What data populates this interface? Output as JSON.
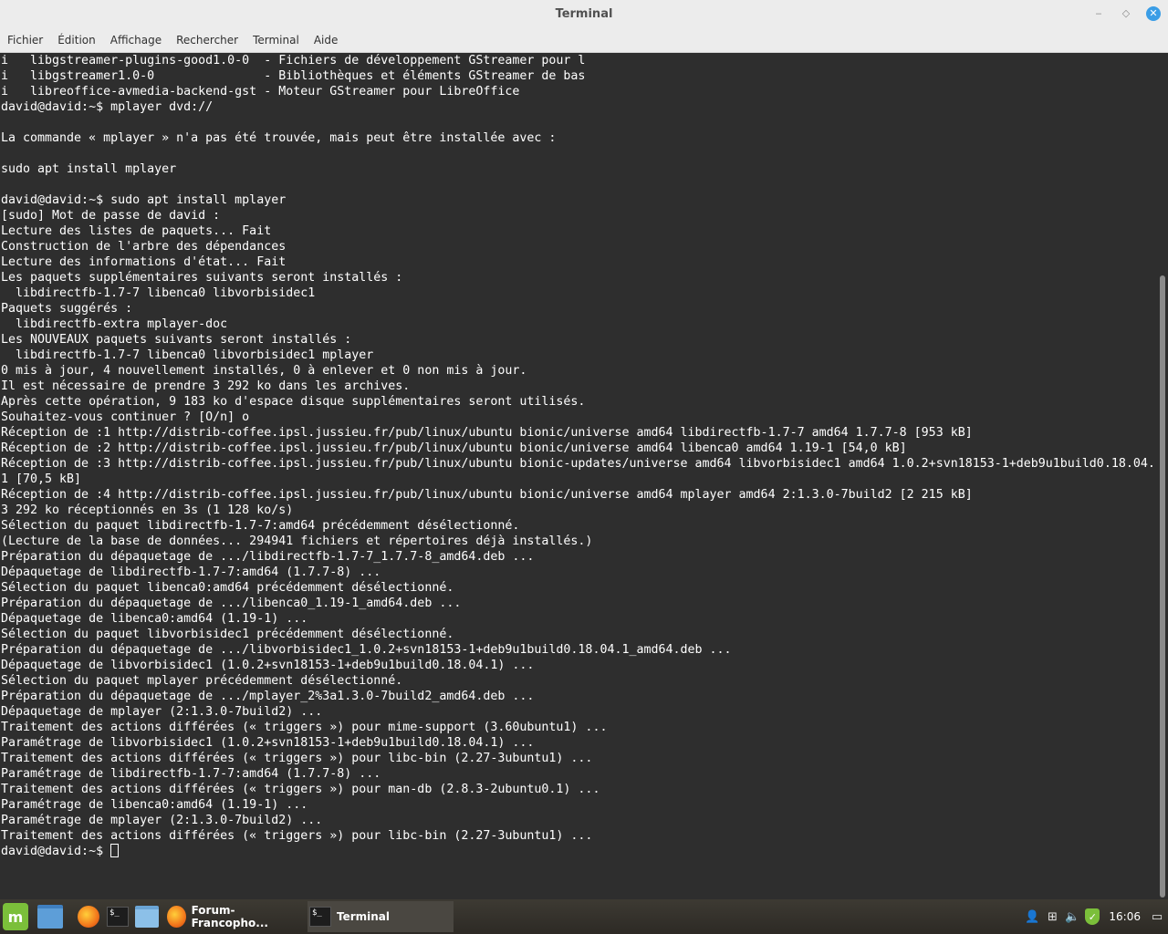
{
  "window": {
    "title": "Terminal",
    "controls": {
      "minimize": "‒",
      "maximize": "◇",
      "close": "✕"
    }
  },
  "menubar": {
    "items": [
      "Fichier",
      "Édition",
      "Affichage",
      "Rechercher",
      "Terminal",
      "Aide"
    ]
  },
  "terminal": {
    "lines": [
      "i   libgstreamer-plugins-good1.0-0  - Fichiers de développement GStreamer pour l",
      "i   libgstreamer1.0-0               - Bibliothèques et éléments GStreamer de bas",
      "i   libreoffice-avmedia-backend-gst - Moteur GStreamer pour LibreOffice",
      "david@david:~$ mplayer dvd://",
      "",
      "La commande « mplayer » n'a pas été trouvée, mais peut être installée avec :",
      "",
      "sudo apt install mplayer",
      "",
      "david@david:~$ sudo apt install mplayer",
      "[sudo] Mot de passe de david :",
      "Lecture des listes de paquets... Fait",
      "Construction de l'arbre des dépendances",
      "Lecture des informations d'état... Fait",
      "Les paquets supplémentaires suivants seront installés :",
      "  libdirectfb-1.7-7 libenca0 libvorbisidec1",
      "Paquets suggérés :",
      "  libdirectfb-extra mplayer-doc",
      "Les NOUVEAUX paquets suivants seront installés :",
      "  libdirectfb-1.7-7 libenca0 libvorbisidec1 mplayer",
      "0 mis à jour, 4 nouvellement installés, 0 à enlever et 0 non mis à jour.",
      "Il est nécessaire de prendre 3 292 ko dans les archives.",
      "Après cette opération, 9 183 ko d'espace disque supplémentaires seront utilisés.",
      "Souhaitez-vous continuer ? [O/n] o",
      "Réception de :1 http://distrib-coffee.ipsl.jussieu.fr/pub/linux/ubuntu bionic/universe amd64 libdirectfb-1.7-7 amd64 1.7.7-8 [953 kB]",
      "Réception de :2 http://distrib-coffee.ipsl.jussieu.fr/pub/linux/ubuntu bionic/universe amd64 libenca0 amd64 1.19-1 [54,0 kB]",
      "Réception de :3 http://distrib-coffee.ipsl.jussieu.fr/pub/linux/ubuntu bionic-updates/universe amd64 libvorbisidec1 amd64 1.0.2+svn18153-1+deb9u1build0.18.04.",
      "1 [70,5 kB]",
      "Réception de :4 http://distrib-coffee.ipsl.jussieu.fr/pub/linux/ubuntu bionic/universe amd64 mplayer amd64 2:1.3.0-7build2 [2 215 kB]",
      "3 292 ko réceptionnés en 3s (1 128 ko/s)",
      "Sélection du paquet libdirectfb-1.7-7:amd64 précédemment désélectionné.",
      "(Lecture de la base de données... 294941 fichiers et répertoires déjà installés.)",
      "Préparation du dépaquetage de .../libdirectfb-1.7-7_1.7.7-8_amd64.deb ...",
      "Dépaquetage de libdirectfb-1.7-7:amd64 (1.7.7-8) ...",
      "Sélection du paquet libenca0:amd64 précédemment désélectionné.",
      "Préparation du dépaquetage de .../libenca0_1.19-1_amd64.deb ...",
      "Dépaquetage de libenca0:amd64 (1.19-1) ...",
      "Sélection du paquet libvorbisidec1 précédemment désélectionné.",
      "Préparation du dépaquetage de .../libvorbisidec1_1.0.2+svn18153-1+deb9u1build0.18.04.1_amd64.deb ...",
      "Dépaquetage de libvorbisidec1 (1.0.2+svn18153-1+deb9u1build0.18.04.1) ...",
      "Sélection du paquet mplayer précédemment désélectionné.",
      "Préparation du dépaquetage de .../mplayer_2%3a1.3.0-7build2_amd64.deb ...",
      "Dépaquetage de mplayer (2:1.3.0-7build2) ...",
      "Traitement des actions différées (« triggers ») pour mime-support (3.60ubuntu1) ...",
      "Paramétrage de libvorbisidec1 (1.0.2+svn18153-1+deb9u1build0.18.04.1) ...",
      "Traitement des actions différées (« triggers ») pour libc-bin (2.27-3ubuntu1) ...",
      "Paramétrage de libdirectfb-1.7-7:amd64 (1.7.7-8) ...",
      "Traitement des actions différées (« triggers ») pour man-db (2.8.3-2ubuntu0.1) ...",
      "Paramétrage de libenca0:amd64 (1.19-1) ...",
      "Paramétrage de mplayer (2:1.3.0-7build2) ...",
      "Traitement des actions différées (« triggers ») pour libc-bin (2.27-3ubuntu1) ..."
    ],
    "prompt": "david@david:~$ "
  },
  "taskbar": {
    "menu_icon": "mint-menu-icon",
    "launchers": [
      "files-icon",
      "firefox-icon",
      "terminal-icon",
      "folder-icon"
    ],
    "tasks": [
      {
        "label": "Forum-Francopho...",
        "icon": "firefox-icon"
      },
      {
        "label": "Terminal",
        "icon": "terminal-icon"
      }
    ],
    "tray_icons": [
      "user-icon",
      "network-icon",
      "volume-icon",
      "update-shield-icon",
      "display-icon"
    ],
    "clock": "16:06"
  },
  "colors": {
    "terminal_bg": "#2e2e2e",
    "terminal_fg": "#ffffff",
    "titlebar_bg": "#ececec",
    "close_button": "#3a9de6",
    "mint_green": "#7bbf3a"
  }
}
